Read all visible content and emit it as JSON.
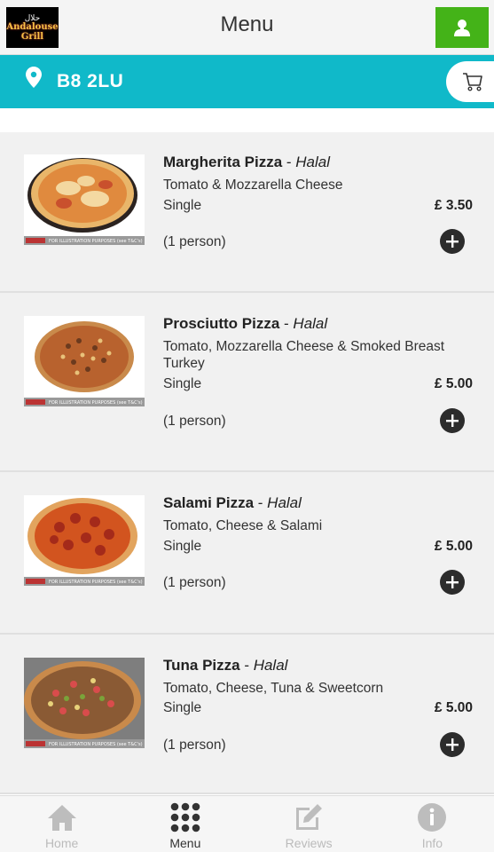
{
  "header": {
    "logo_arabic": "حلال",
    "logo_line1": "Andalouse",
    "logo_line2": "Grill",
    "title": "Menu"
  },
  "location": {
    "postcode": "B8 2LU"
  },
  "illustration_note": "FOR ILLUSTRATION PURPOSES (see T&C's)",
  "items": [
    {
      "name": "Margherita Pizza",
      "tag": "Halal",
      "desc": "Tomato & Mozzarella Cheese",
      "size": "Single",
      "price": "£ 3.50",
      "serves": "(1 person)"
    },
    {
      "name": "Prosciutto Pizza",
      "tag": "Halal",
      "desc": "Tomato, Mozzarella Cheese & Smoked Breast Turkey",
      "size": "Single",
      "price": "£ 5.00",
      "serves": "(1 person)"
    },
    {
      "name": "Salami Pizza",
      "tag": "Halal",
      "desc": "Tomato, Cheese & Salami",
      "size": "Single",
      "price": "£ 5.00",
      "serves": "(1 person)"
    },
    {
      "name": "Tuna Pizza",
      "tag": "Halal",
      "desc": "Tomato, Cheese, Tuna & Sweetcorn",
      "size": "Single",
      "price": "£ 5.00",
      "serves": "(1 person)"
    }
  ],
  "nav": [
    {
      "label": "Home",
      "icon": "home-icon",
      "active": false
    },
    {
      "label": "Menu",
      "icon": "grid-icon",
      "active": true
    },
    {
      "label": "Reviews",
      "icon": "edit-icon",
      "active": false
    },
    {
      "label": "Info",
      "icon": "info-icon",
      "active": false
    }
  ],
  "colors": {
    "accent_teal": "#10b9c9",
    "account_green": "#44b318",
    "card_bg": "#f1f1f1"
  }
}
